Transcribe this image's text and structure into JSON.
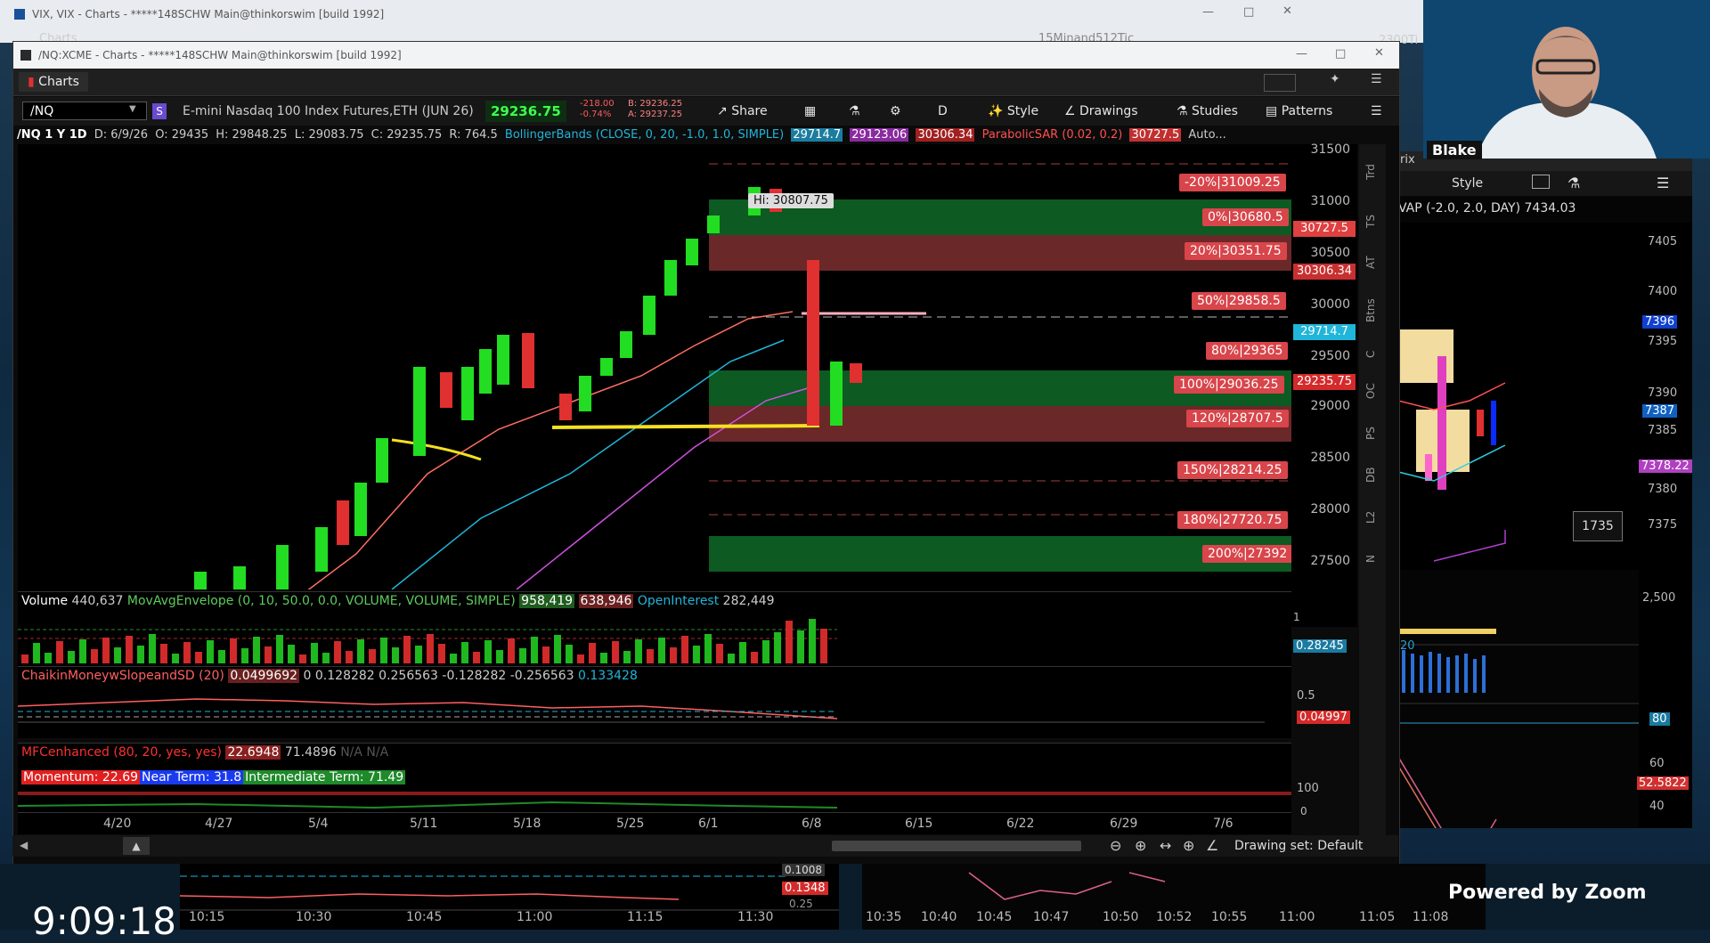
{
  "back_window": {
    "title": "VIX, VIX - Charts - *****148SCHW Main@thinkorswim [build 1992]",
    "tab": "Charts",
    "right_text": "15Minand512Tic",
    "partial": "2300Ti"
  },
  "main_window": {
    "title": "/NQ:XCME - Charts - *****148SCHW Main@thinkorswim [build 1992]",
    "tab": "Charts"
  },
  "toolbar": {
    "symbol": "/NQ",
    "badge": "S",
    "description": "E-mini Nasdaq 100 Index Futures,ETH (JUN 26)",
    "last": "29236.75",
    "change": "-218.00",
    "change_pct": "-0.74%",
    "bid": "B: 29236.25",
    "ask": "A: 29237.25",
    "share": "Share",
    "aggregation": "D",
    "style": "Style",
    "drawings": "Drawings",
    "studies": "Studies",
    "patterns": "Patterns"
  },
  "infobar": {
    "period": "/NQ 1 Y 1D",
    "date": "D: 6/9/26",
    "open": "O: 29435",
    "high": "H: 29848.25",
    "low": "L: 29083.75",
    "close": "C: 29235.75",
    "range": "R: 764.5",
    "study": "BollingerBands (CLOSE, 0, 20, -1.0, 1.0, SIMPLE)",
    "bb1": "29714.7",
    "bb2": "29123.06",
    "bb3": "30306.34",
    "sar": "ParabolicSAR (0.02, 0.2)",
    "sar_val": "30727.5",
    "auto": "Auto..."
  },
  "price_axis": {
    "ticks": [
      "31500",
      "31000",
      "30500",
      "30000",
      "29500",
      "29000",
      "28500",
      "28000",
      "27500"
    ],
    "tags": [
      {
        "text": "30727.5",
        "color": "#e04040"
      },
      {
        "text": "30306.34",
        "color": "#c83030"
      },
      {
        "text": "29714.7",
        "color": "#21b5d9"
      },
      {
        "text": "29235.75",
        "color": "#d42a2a"
      }
    ]
  },
  "hi_label": "Hi: 30807.75",
  "fib_levels": [
    "-20%|31009.25",
    "0%|30680.5",
    "20%|30351.75",
    "50%|29858.5",
    "80%|29365",
    "100%|29036.25",
    "120%|28707.5",
    "150%|28214.25",
    "180%|27720.75",
    "200%|27392"
  ],
  "right_tabs": [
    "Trd",
    "TS",
    "AT",
    "Btns",
    "C",
    "OC",
    "PS",
    "DB",
    "L2",
    "N"
  ],
  "volume_pane": {
    "label": "Volume",
    "value": "440,637",
    "study": "MovAvgEnvelope (0, 10, 50.0, 0.0, VOLUME, VOLUME, SIMPLE)",
    "v1": "958,419",
    "v2": "638,946",
    "oi_label": "OpenInterest",
    "oi": "282,449",
    "axis_top": "1",
    "tag": "0.28245"
  },
  "chaikin_pane": {
    "study": "ChaikinMoneywSlopeandSD (20)",
    "vals": [
      "0.0499692",
      "0",
      "0.128282",
      "0.256563",
      "-0.128282",
      "-0.256563"
    ],
    "last": "0.133428",
    "axis": "0.5",
    "tag": "0.04997"
  },
  "mfc_pane": {
    "study": "MFCenhanced (80, 20, yes, yes)",
    "v1": "22.6948",
    "v2": "71.4896",
    "na1": "N/A",
    "na2": "N/A",
    "momentum": "Momentum: 22.69",
    "near": "Near Term: 31.8",
    "intermediate": "Intermediate Term: 71.49",
    "axis": "100",
    "axis0": "0"
  },
  "date_axis": [
    "4/20",
    "4/27",
    "5/4",
    "5/11",
    "5/18",
    "5/25",
    "6/1",
    "6/8",
    "6/15",
    "6/22",
    "6/29",
    "7/6"
  ],
  "bottom_bar": {
    "drawing_set": "Drawing set: Default"
  },
  "right_window": {
    "style": "Style",
    "study": "VAP (-2.0, 2.0, DAY)",
    "study_val": "7434.03",
    "ticks": [
      "7405",
      "7400",
      "7395",
      "7390",
      "7385",
      "7380",
      "7375"
    ],
    "tag1": "7396",
    "tag2": "7387",
    "tag3": "7378.22",
    "badge": "1735",
    "vol_tick": "2,500",
    "sub_label": "20",
    "osc_ticks": [
      "80",
      "60",
      "40"
    ],
    "osc_tag": "52.5822",
    "partial": "rix"
  },
  "behind_bottom": {
    "times_left": [
      "10:15",
      "10:30",
      "10:45",
      "11:00",
      "11:15",
      "11:30"
    ],
    "times_right": [
      "10:35",
      "10:40",
      "10:45",
      "10:47",
      "10:50",
      "10:52",
      "10:55",
      "11:00",
      "11:05",
      "11:08"
    ],
    "tag1": "0.1348",
    "tag2": "0.25",
    "tag3": "0.1008"
  },
  "webcam": {
    "name": "Blake"
  },
  "clock": "9:09:18",
  "zoom": "Powered by Zoom"
}
